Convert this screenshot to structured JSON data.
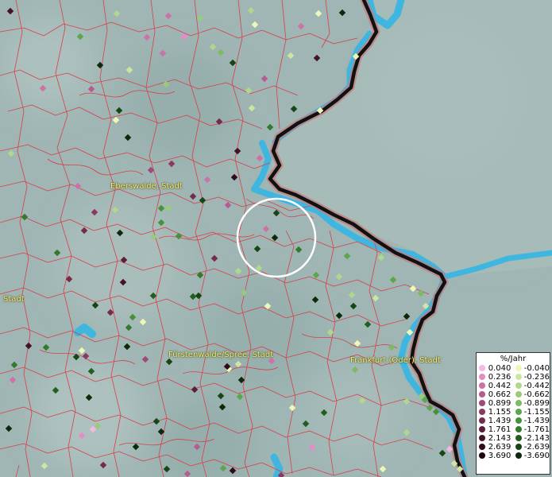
{
  "cities": [
    {
      "id": "eberswalde",
      "label": "Eberswalde, Stadt"
    },
    {
      "id": "fuerstenwalde",
      "label": "Fürstenwalde/Spree, Stadt"
    },
    {
      "id": "frankfurt",
      "label": "Frankfurt (Oder), Stadt"
    },
    {
      "id": "edge",
      "label": "Stadt"
    }
  ],
  "legend": {
    "title": "%/Jahr",
    "rows": [
      {
        "pos": "0.040",
        "pos_color": "#f4b8e4",
        "neg": "-0.040",
        "neg_color": "#eef7b4"
      },
      {
        "pos": "0.236",
        "pos_color": "#e48cc8",
        "neg": "-0.236",
        "neg_color": "#cde6a2"
      },
      {
        "pos": "0.442",
        "pos_color": "#cc72a8",
        "neg": "-0.442",
        "neg_color": "#b0d88c"
      },
      {
        "pos": "0.662",
        "pos_color": "#b65c90",
        "neg": "-0.662",
        "neg_color": "#98cb7a"
      },
      {
        "pos": "0.899",
        "pos_color": "#a04a78",
        "neg": "-0.899",
        "neg_color": "#7eba64"
      },
      {
        "pos": "1.155",
        "pos_color": "#8a3a62",
        "neg": "-1.155",
        "neg_color": "#5ea64e"
      },
      {
        "pos": "1.439",
        "pos_color": "#742c4e",
        "neg": "-1.439",
        "neg_color": "#46923c"
      },
      {
        "pos": "1.761",
        "pos_color": "#5c1e3a",
        "neg": "-1.761",
        "neg_color": "#327a2c"
      },
      {
        "pos": "2.143",
        "pos_color": "#46122a",
        "neg": "-2.143",
        "neg_color": "#225e1e"
      },
      {
        "pos": "2.639",
        "pos_color": "#300a1c",
        "neg": "-2.639",
        "neg_color": "#164614"
      },
      {
        "pos": "3.690",
        "pos_color": "#1c0410",
        "neg": "-3.690",
        "neg_color": "#0c2a0a"
      }
    ]
  },
  "colors": {
    "background": "#9fb6b4",
    "district_borders": "#d8404a",
    "river": "#3fb6e0",
    "national_border": "#111111",
    "selection_circle": "#ffffff"
  }
}
